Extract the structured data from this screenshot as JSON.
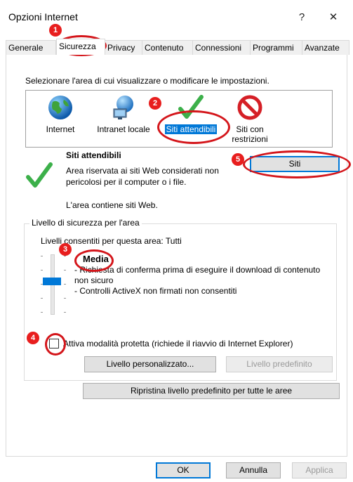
{
  "window": {
    "title": "Opzioni Internet",
    "help_glyph": "?",
    "close_glyph": "✕"
  },
  "tabs": [
    "Generale",
    "Sicurezza",
    "Privacy",
    "Contenuto",
    "Connessioni",
    "Programmi",
    "Avanzate"
  ],
  "active_tab": "Sicurezza",
  "zones": {
    "prompt": "Selezionare l'area di cui visualizzare o modificare le impostazioni.",
    "items": [
      {
        "label": "Internet",
        "icon": "globe-icon"
      },
      {
        "label": "Intranet locale",
        "icon": "network-globe-icon"
      },
      {
        "label": "Siti attendibili",
        "icon": "checkmark-icon",
        "selected": true
      },
      {
        "label": "Siti con\nrestrizioni",
        "icon": "no-entry-icon"
      }
    ]
  },
  "zone_info": {
    "title": "Siti attendibili",
    "description": "Area riservata ai siti Web considerati non pericolosi per il computer o i file.",
    "contains": "L'area contiene siti Web.",
    "sites_button": "Siti"
  },
  "security_level": {
    "group_title": "Livello di sicurezza per l'area",
    "allowed_levels": "Livelli consentiti per questa area: Tutti",
    "level_name": "Media",
    "bullet1": "- Richiesta di conferma prima di eseguire il download di contenuto non sicuro",
    "bullet2": "- Controlli ActiveX non firmati non consentiti",
    "protected_mode_label": "Attiva modalità protetta (richiede il riavvio di Internet Explorer)",
    "protected_mode_checked": false,
    "custom_level_button": "Livello personalizzato...",
    "default_level_button": "Livello predefinito",
    "reset_all_button": "Ripristina livello predefinito per tutte le aree"
  },
  "footer": {
    "ok": "OK",
    "cancel": "Annulla",
    "apply": "Applica"
  },
  "annotations": [
    "1",
    "2",
    "3",
    "4",
    "5"
  ],
  "colors": {
    "selection": "#0078d7",
    "annotation": "#d4161b",
    "check": "#3cb04a"
  }
}
